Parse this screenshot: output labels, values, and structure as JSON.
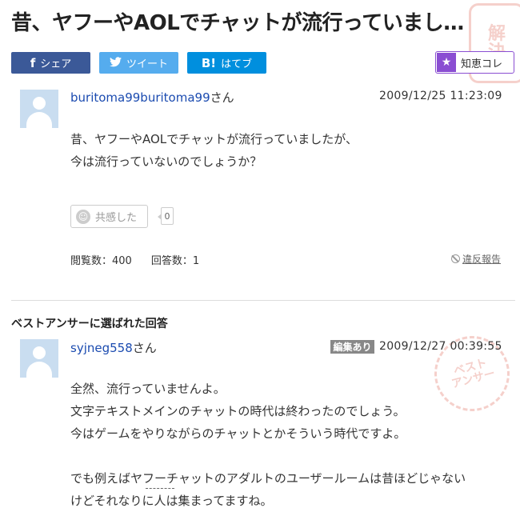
{
  "page": {
    "title": "昔、ヤフーやAOLでチャットが流行っていまし…"
  },
  "share": {
    "facebook": {
      "icon": "facebook-icon",
      "label": "シェア"
    },
    "twitter": {
      "icon": "twitter-bird-icon",
      "label": "ツイート"
    },
    "hatena": {
      "icon": "hatena-bookmark-icon",
      "icon_text": "B!",
      "label": "はてブ"
    },
    "chie_kore": {
      "icon": "star-icon",
      "label": "知恵コレ"
    }
  },
  "question": {
    "username": "buritoma99buritoma99",
    "honorific": "さん",
    "date": "2009/12/25  11:23:09",
    "lines": [
      "昔、ヤフーやAOLでチャットが流行っていましたが、",
      "今は流行っていないのでしょうか？"
    ],
    "empathy_label": "共感した",
    "empathy_count": "0",
    "views": "閲覧数：400",
    "answers": "回答数：1",
    "report": "違反報告"
  },
  "best_answer": {
    "heading": "ベストアンサーに選ばれた回答",
    "username": "syjneg558",
    "honorific": "さん",
    "edited_badge": "編集あり",
    "date": "2009/12/27  00:39:55",
    "lines": [
      "全然、流行っていませんよ。",
      "文字テキストメインのチャットの時代は終わったのでしょう。",
      "今はゲームをやりながらのチャットとかそういう時代ですよ。",
      "",
      "でも例えばヤフーチャットのアダルトのユーザールームは昔ほどじゃない",
      "けどそれなりに人は集まってますね。"
    ]
  },
  "colors": {
    "facebook": "#3b5998",
    "twitter": "#55acee",
    "hatena": "#008fde",
    "chie": "#8a4ed2",
    "link": "#1b4bb0"
  }
}
